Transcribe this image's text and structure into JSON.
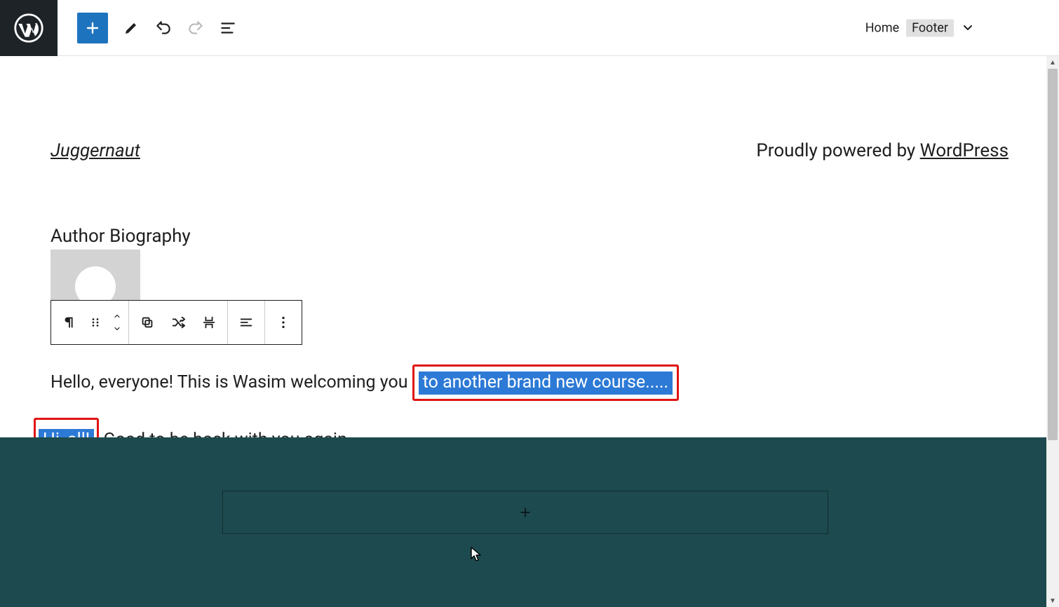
{
  "breadcrumb": {
    "home": "Home",
    "current": "Footer"
  },
  "siteTitle": "Juggernaut",
  "powered": {
    "prefix": "Proudly powered by ",
    "link": "WordPress"
  },
  "bio": {
    "heading": "Author Biography",
    "para1_pre": "Hello, everyone! This is Wasim welcoming you ",
    "para1_sel": "to another brand new course.....",
    "para2_sel": "Hi, all!",
    "para2_rest": " Good to be back with you again."
  }
}
